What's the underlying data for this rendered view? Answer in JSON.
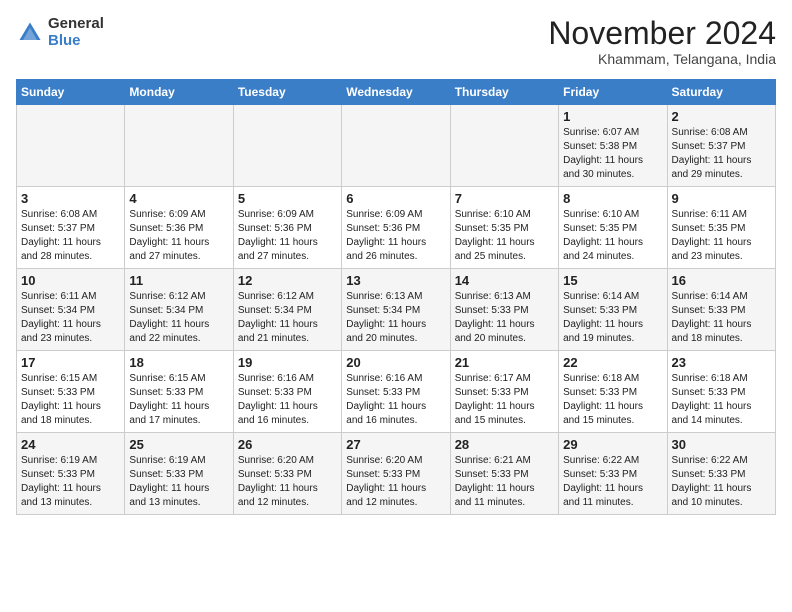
{
  "logo": {
    "general": "General",
    "blue": "Blue"
  },
  "header": {
    "month": "November 2024",
    "location": "Khammam, Telangana, India"
  },
  "weekdays": [
    "Sunday",
    "Monday",
    "Tuesday",
    "Wednesday",
    "Thursday",
    "Friday",
    "Saturday"
  ],
  "weeks": [
    [
      {
        "day": "",
        "info": ""
      },
      {
        "day": "",
        "info": ""
      },
      {
        "day": "",
        "info": ""
      },
      {
        "day": "",
        "info": ""
      },
      {
        "day": "",
        "info": ""
      },
      {
        "day": "1",
        "info": "Sunrise: 6:07 AM\nSunset: 5:38 PM\nDaylight: 11 hours\nand 30 minutes."
      },
      {
        "day": "2",
        "info": "Sunrise: 6:08 AM\nSunset: 5:37 PM\nDaylight: 11 hours\nand 29 minutes."
      }
    ],
    [
      {
        "day": "3",
        "info": "Sunrise: 6:08 AM\nSunset: 5:37 PM\nDaylight: 11 hours\nand 28 minutes."
      },
      {
        "day": "4",
        "info": "Sunrise: 6:09 AM\nSunset: 5:36 PM\nDaylight: 11 hours\nand 27 minutes."
      },
      {
        "day": "5",
        "info": "Sunrise: 6:09 AM\nSunset: 5:36 PM\nDaylight: 11 hours\nand 27 minutes."
      },
      {
        "day": "6",
        "info": "Sunrise: 6:09 AM\nSunset: 5:36 PM\nDaylight: 11 hours\nand 26 minutes."
      },
      {
        "day": "7",
        "info": "Sunrise: 6:10 AM\nSunset: 5:35 PM\nDaylight: 11 hours\nand 25 minutes."
      },
      {
        "day": "8",
        "info": "Sunrise: 6:10 AM\nSunset: 5:35 PM\nDaylight: 11 hours\nand 24 minutes."
      },
      {
        "day": "9",
        "info": "Sunrise: 6:11 AM\nSunset: 5:35 PM\nDaylight: 11 hours\nand 23 minutes."
      }
    ],
    [
      {
        "day": "10",
        "info": "Sunrise: 6:11 AM\nSunset: 5:34 PM\nDaylight: 11 hours\nand 23 minutes."
      },
      {
        "day": "11",
        "info": "Sunrise: 6:12 AM\nSunset: 5:34 PM\nDaylight: 11 hours\nand 22 minutes."
      },
      {
        "day": "12",
        "info": "Sunrise: 6:12 AM\nSunset: 5:34 PM\nDaylight: 11 hours\nand 21 minutes."
      },
      {
        "day": "13",
        "info": "Sunrise: 6:13 AM\nSunset: 5:34 PM\nDaylight: 11 hours\nand 20 minutes."
      },
      {
        "day": "14",
        "info": "Sunrise: 6:13 AM\nSunset: 5:33 PM\nDaylight: 11 hours\nand 20 minutes."
      },
      {
        "day": "15",
        "info": "Sunrise: 6:14 AM\nSunset: 5:33 PM\nDaylight: 11 hours\nand 19 minutes."
      },
      {
        "day": "16",
        "info": "Sunrise: 6:14 AM\nSunset: 5:33 PM\nDaylight: 11 hours\nand 18 minutes."
      }
    ],
    [
      {
        "day": "17",
        "info": "Sunrise: 6:15 AM\nSunset: 5:33 PM\nDaylight: 11 hours\nand 18 minutes."
      },
      {
        "day": "18",
        "info": "Sunrise: 6:15 AM\nSunset: 5:33 PM\nDaylight: 11 hours\nand 17 minutes."
      },
      {
        "day": "19",
        "info": "Sunrise: 6:16 AM\nSunset: 5:33 PM\nDaylight: 11 hours\nand 16 minutes."
      },
      {
        "day": "20",
        "info": "Sunrise: 6:16 AM\nSunset: 5:33 PM\nDaylight: 11 hours\nand 16 minutes."
      },
      {
        "day": "21",
        "info": "Sunrise: 6:17 AM\nSunset: 5:33 PM\nDaylight: 11 hours\nand 15 minutes."
      },
      {
        "day": "22",
        "info": "Sunrise: 6:18 AM\nSunset: 5:33 PM\nDaylight: 11 hours\nand 15 minutes."
      },
      {
        "day": "23",
        "info": "Sunrise: 6:18 AM\nSunset: 5:33 PM\nDaylight: 11 hours\nand 14 minutes."
      }
    ],
    [
      {
        "day": "24",
        "info": "Sunrise: 6:19 AM\nSunset: 5:33 PM\nDaylight: 11 hours\nand 13 minutes."
      },
      {
        "day": "25",
        "info": "Sunrise: 6:19 AM\nSunset: 5:33 PM\nDaylight: 11 hours\nand 13 minutes."
      },
      {
        "day": "26",
        "info": "Sunrise: 6:20 AM\nSunset: 5:33 PM\nDaylight: 11 hours\nand 12 minutes."
      },
      {
        "day": "27",
        "info": "Sunrise: 6:20 AM\nSunset: 5:33 PM\nDaylight: 11 hours\nand 12 minutes."
      },
      {
        "day": "28",
        "info": "Sunrise: 6:21 AM\nSunset: 5:33 PM\nDaylight: 11 hours\nand 11 minutes."
      },
      {
        "day": "29",
        "info": "Sunrise: 6:22 AM\nSunset: 5:33 PM\nDaylight: 11 hours\nand 11 minutes."
      },
      {
        "day": "30",
        "info": "Sunrise: 6:22 AM\nSunset: 5:33 PM\nDaylight: 11 hours\nand 10 minutes."
      }
    ]
  ]
}
